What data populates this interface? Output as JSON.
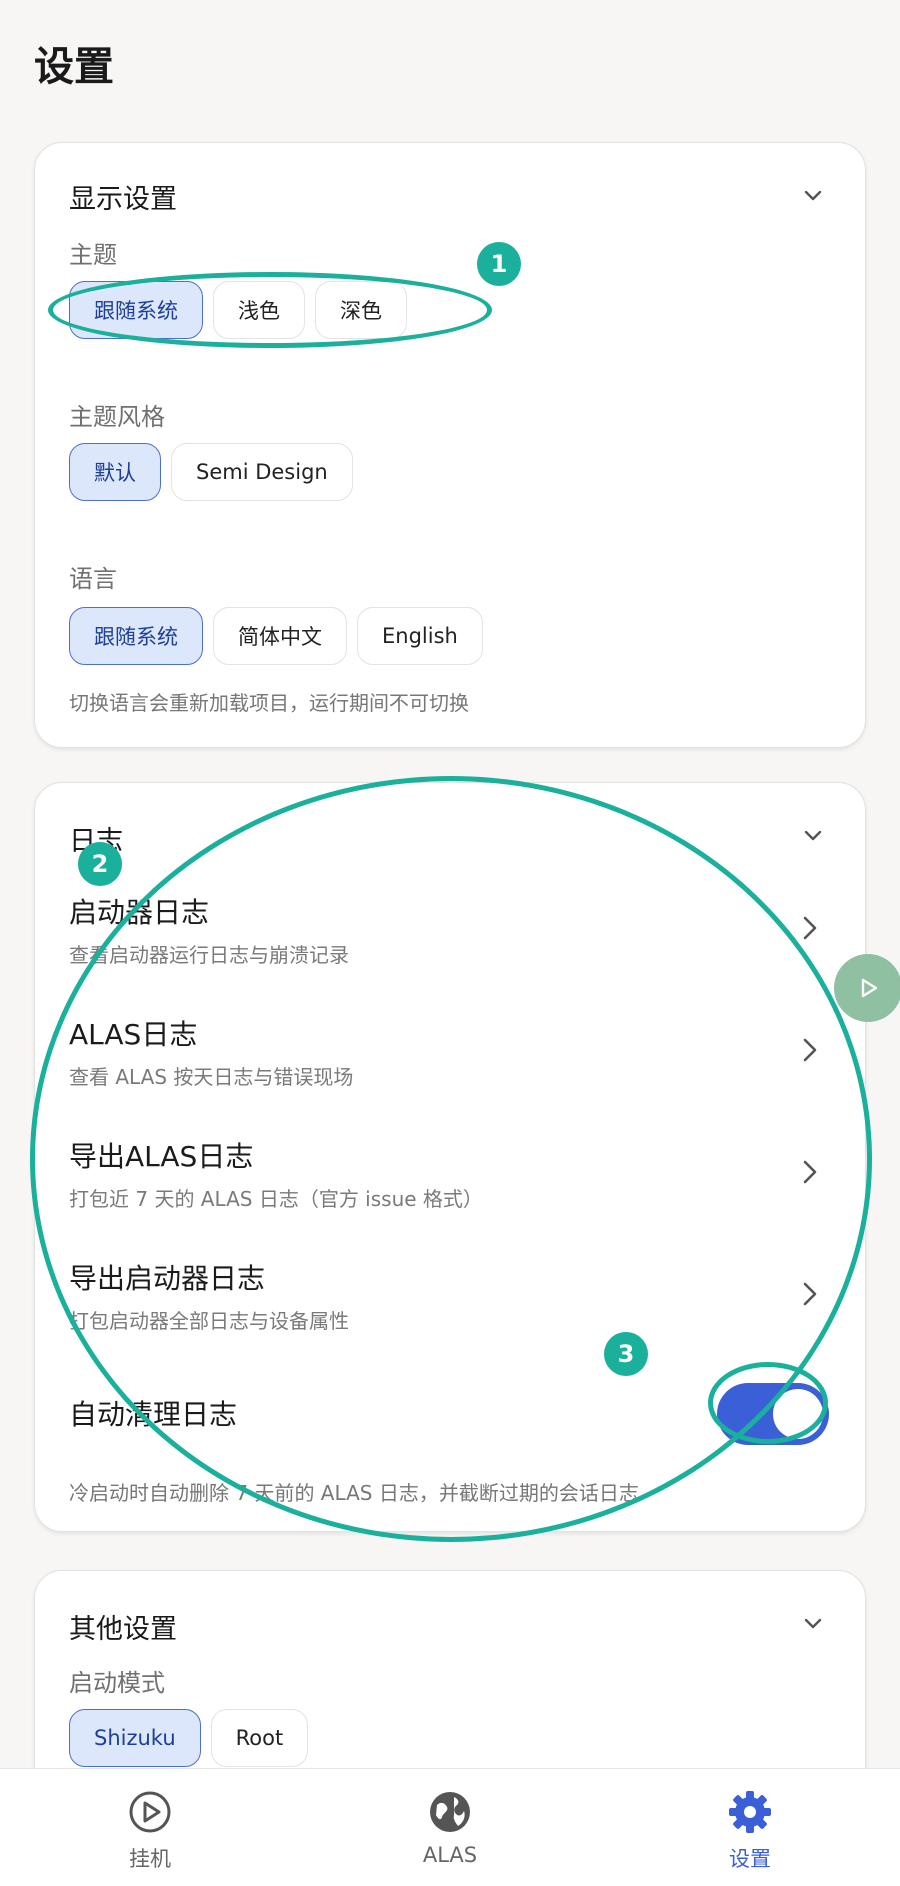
{
  "page_title": "设置",
  "display_settings": {
    "title": "显示设置",
    "theme_label": "主题",
    "theme_options": [
      "跟随系统",
      "浅色",
      "深色"
    ],
    "theme_selected": 0,
    "style_label": "主题风格",
    "style_options": [
      "默认",
      "Semi Design"
    ],
    "style_selected": 0,
    "language_label": "语言",
    "language_options": [
      "跟随系统",
      "简体中文",
      "English"
    ],
    "language_selected": 0,
    "language_hint": "切换语言会重新加载项目，运行期间不可切换"
  },
  "logs": {
    "title": "日志",
    "items": [
      {
        "title": "启动器日志",
        "subtitle": "查看启动器运行日志与崩溃记录"
      },
      {
        "title": "ALAS日志",
        "subtitle": "查看 ALAS 按天日志与错误现场"
      },
      {
        "title": "导出ALAS日志",
        "subtitle": "打包近 7 天的 ALAS 日志（官方 issue 格式）"
      },
      {
        "title": "导出启动器日志",
        "subtitle": "打包启动器全部日志与设备属性"
      }
    ],
    "auto_clean_label": "自动清理日志",
    "auto_clean_enabled": true,
    "auto_clean_hint": "冷启动时自动删除 7 天前的 ALAS 日志，并截断过期的会话日志"
  },
  "other_settings": {
    "title": "其他设置",
    "launch_mode_label": "启动模式",
    "launch_mode_options": [
      "Shizuku",
      "Root"
    ],
    "launch_mode_selected": 0
  },
  "annotations": [
    "1",
    "2",
    "3"
  ],
  "bottom_nav": {
    "items": [
      "挂机",
      "ALAS",
      "设置"
    ],
    "active": 2
  },
  "colors": {
    "accent": "#3a5fd6",
    "annotation": "#1ab09c",
    "chip_selected_bg": "#dde7fb"
  }
}
